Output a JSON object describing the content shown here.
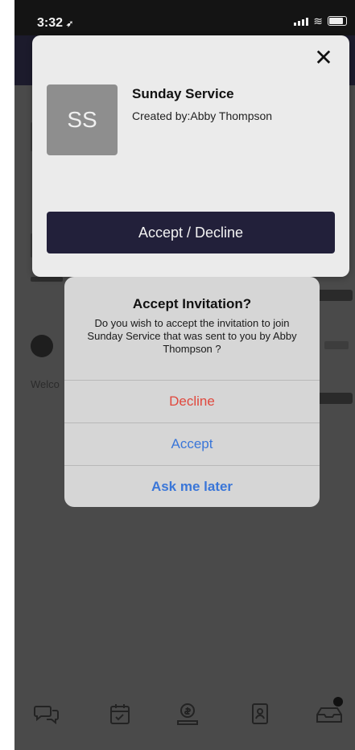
{
  "status_bar": {
    "time": "3:32",
    "location_glyph": "➶"
  },
  "card": {
    "avatar_initials": "SS",
    "title": "Sunday Service",
    "creator": "Created by:Abby Thompson",
    "close_glyph": "✕",
    "action_label": "Accept / Decline"
  },
  "alert": {
    "title": "Accept Invitation?",
    "message": "Do you wish to accept the invitation to join Sunday Service that was sent to you by Abby Thompson ?",
    "buttons": {
      "decline": "Decline",
      "accept": "Accept",
      "later": "Ask me later"
    }
  },
  "background": {
    "welcome_fragment": "Welco"
  },
  "tabbar": {
    "icons": [
      "chat-icon",
      "calendar-icon",
      "donate-icon",
      "contacts-icon",
      "inbox-icon"
    ]
  },
  "colors": {
    "accent_dark": "#22203a",
    "decline": "#e0483d",
    "link": "#3a76d8"
  }
}
